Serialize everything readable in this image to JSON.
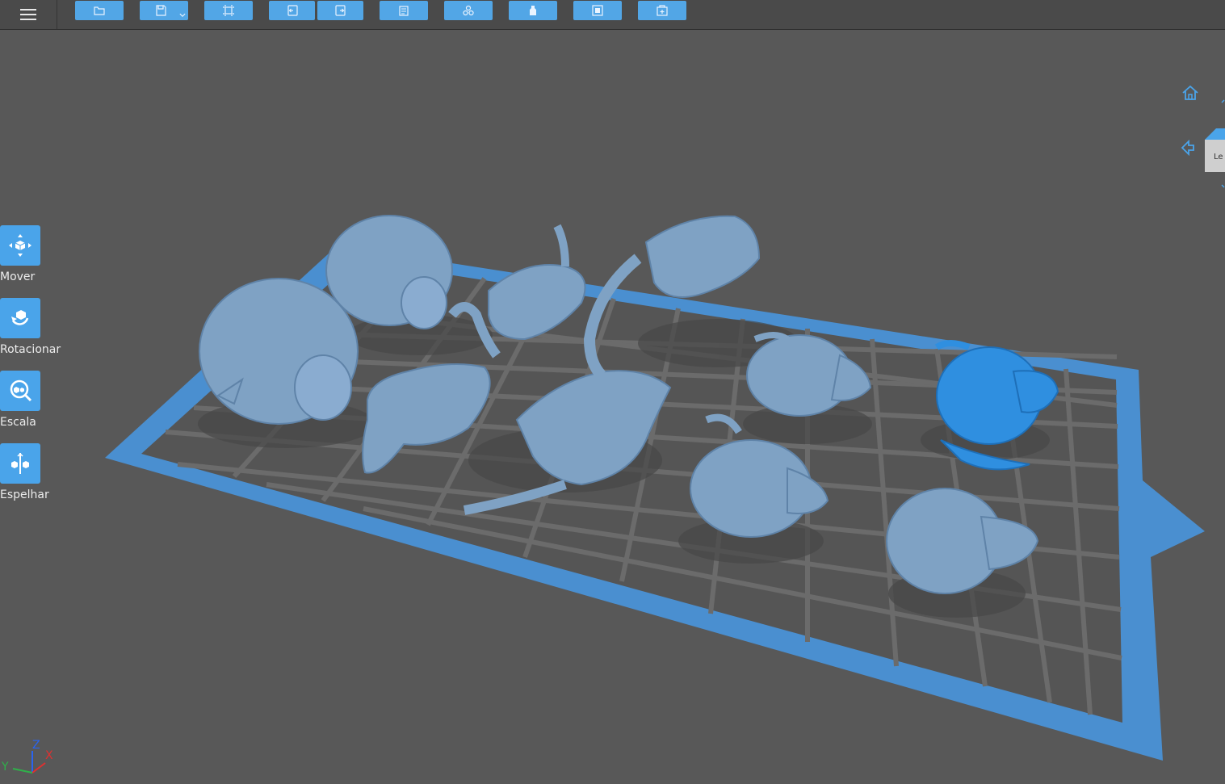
{
  "toolbar": {
    "menu_icon": "hamburger-menu-icon",
    "buttons": [
      {
        "name": "open-file",
        "icon": "folder-icon"
      },
      {
        "name": "save",
        "icon": "floppy-disk-icon",
        "has_dropdown": true
      },
      {
        "name": "fit-view",
        "icon": "frame-icon"
      },
      {
        "name": "undo",
        "icon": "undo-icon"
      },
      {
        "name": "redo",
        "icon": "redo-icon"
      },
      {
        "name": "copy",
        "icon": "copy-icon"
      },
      {
        "name": "arrange",
        "icon": "arrange-icon"
      },
      {
        "name": "supports",
        "icon": "bottle-icon"
      },
      {
        "name": "hollow",
        "icon": "hollow-icon"
      },
      {
        "name": "add",
        "icon": "add-box-icon"
      }
    ],
    "accent": "#52a6e6"
  },
  "left_tools": [
    {
      "label": "Mover",
      "icon": "move-icon"
    },
    {
      "label": "Rotacionar",
      "icon": "rotate-icon"
    },
    {
      "label": "Escala",
      "icon": "scale-icon"
    },
    {
      "label": "Espelhar",
      "icon": "mirror-icon"
    }
  ],
  "view_cube": {
    "face_label": "Le"
  },
  "axis_indicator": {
    "x": "X",
    "y": "Y",
    "z": "Z"
  },
  "colors": {
    "background": "#585858",
    "plate_border": "#4a8fd0",
    "plate_grid": "#6a6a6a",
    "model": "#7fa2c4",
    "selected_model": "#2f8fe0"
  }
}
